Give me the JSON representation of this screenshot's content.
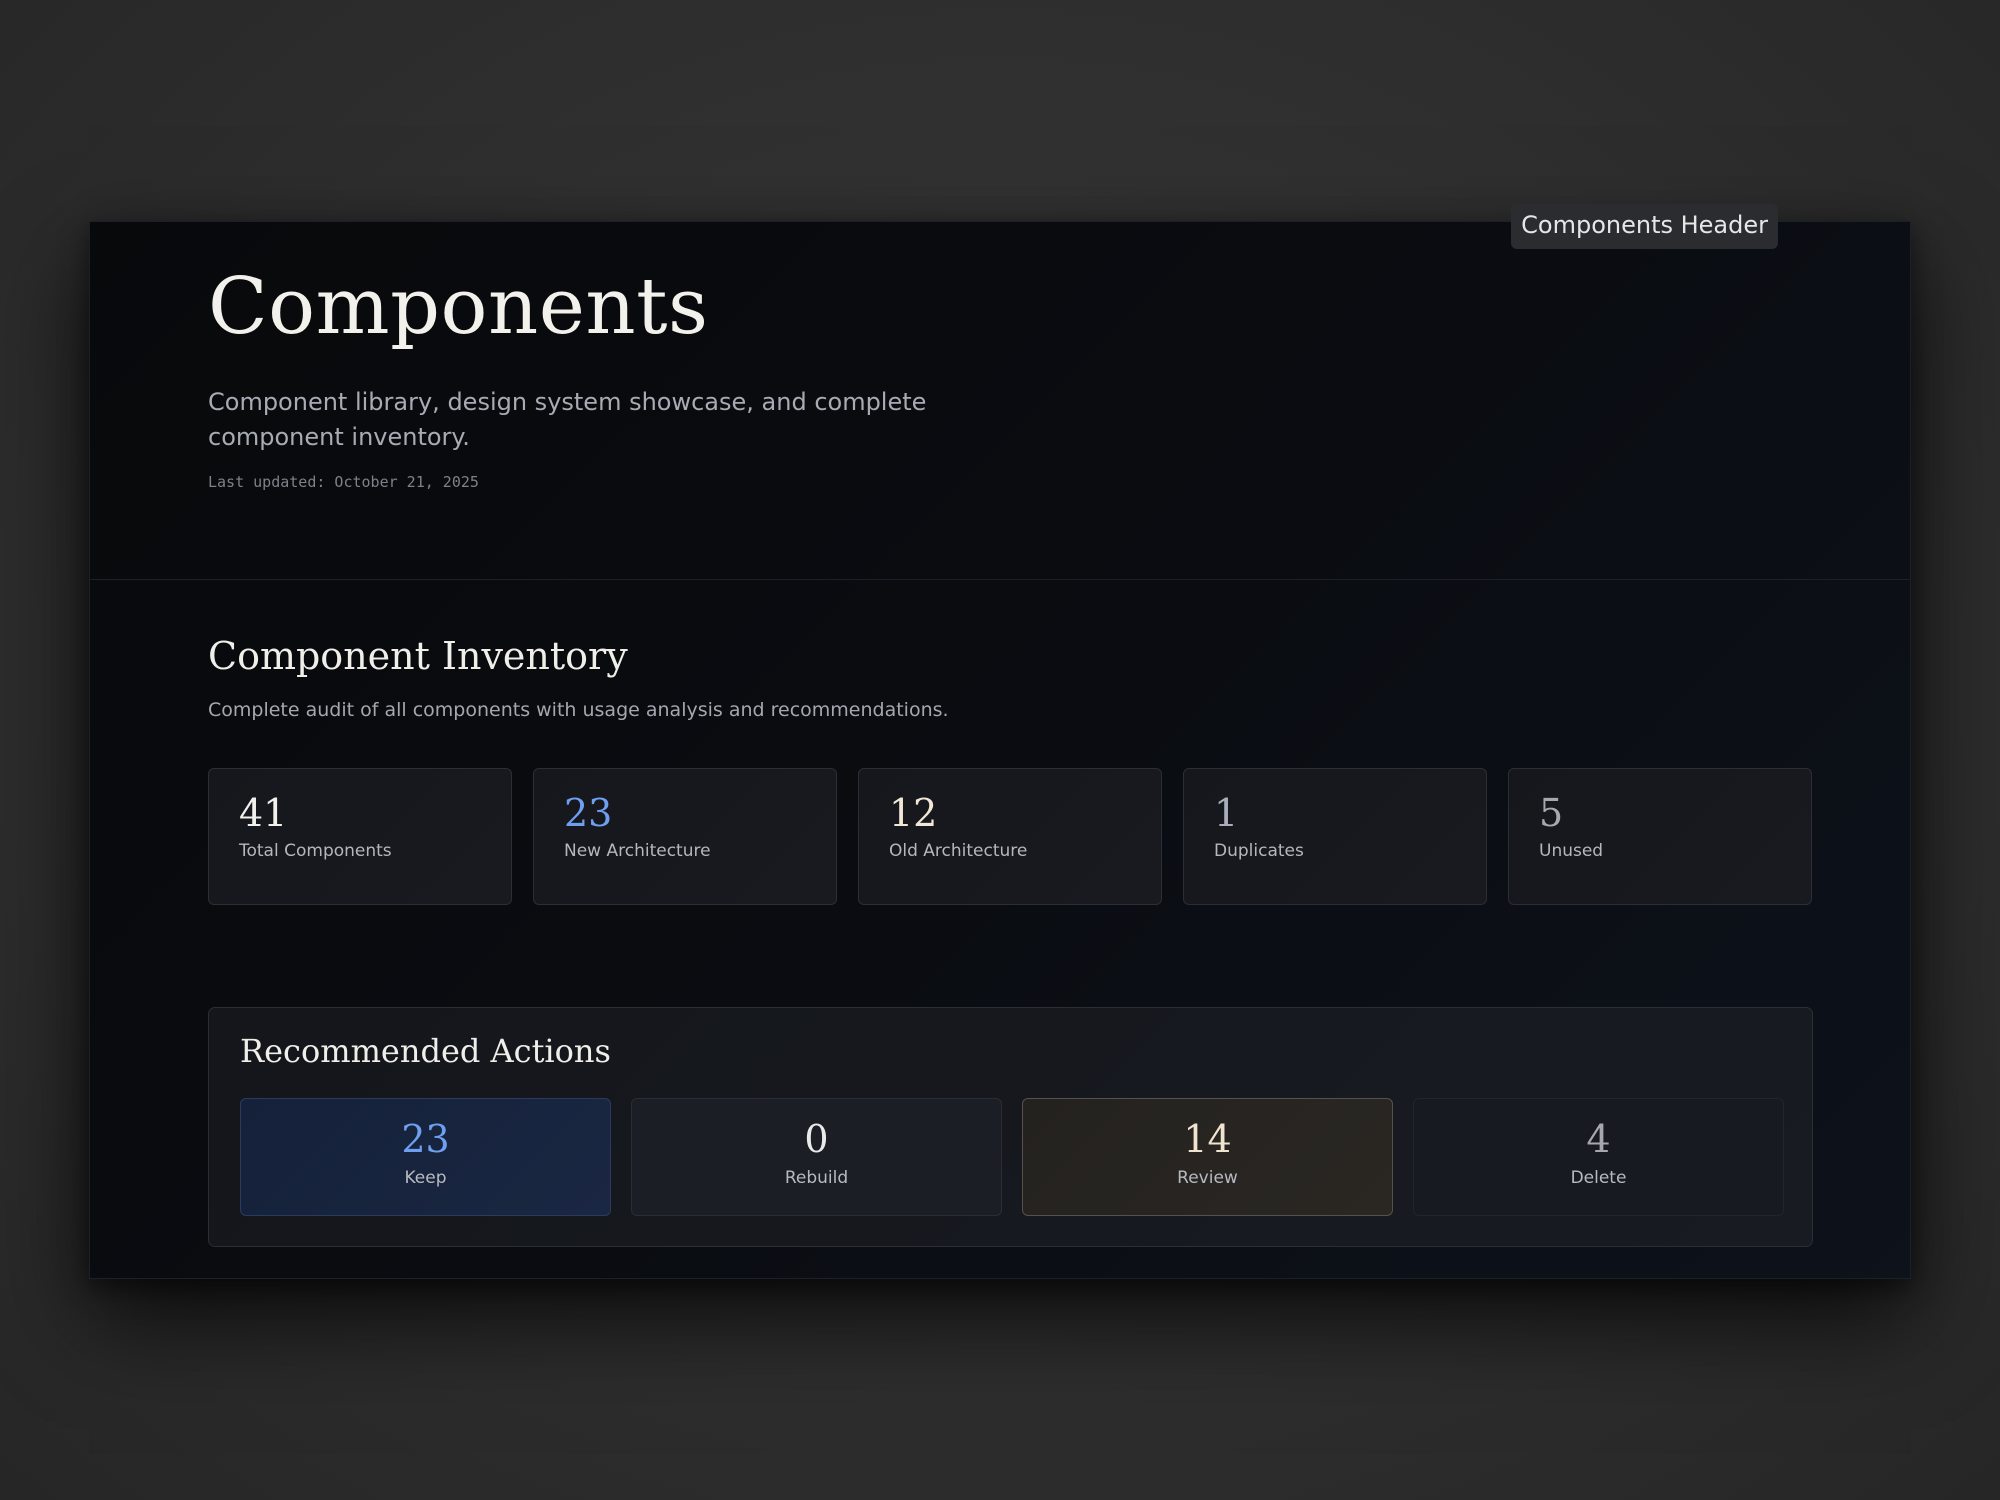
{
  "tooltip": {
    "label": "Components Header"
  },
  "header": {
    "title": "Components",
    "subtitle": "Component library, design system showcase, and complete component inventory.",
    "last_updated": "Last updated: October 21, 2025"
  },
  "inventory": {
    "title": "Component Inventory",
    "description": "Complete audit of all components with usage analysis and recommendations.",
    "stats": [
      {
        "value": "41",
        "label": "Total Components",
        "color": "#f2f0ea"
      },
      {
        "value": "23",
        "label": "New Architecture",
        "color": "#6f9ff0"
      },
      {
        "value": "12",
        "label": "Old Architecture",
        "color": "#f2e6d6"
      },
      {
        "value": "1",
        "label": "Duplicates",
        "color": "#a8aebb"
      },
      {
        "value": "5",
        "label": "Unused",
        "color": "#a6a8ad"
      }
    ]
  },
  "actions": {
    "title": "Recommended Actions",
    "items": [
      {
        "value": "23",
        "label": "Keep",
        "color": "#6f9ff0"
      },
      {
        "value": "0",
        "label": "Rebuild",
        "color": "#e9e9ea"
      },
      {
        "value": "14",
        "label": "Review",
        "color": "#f0e3cf"
      },
      {
        "value": "4",
        "label": "Delete",
        "color": "#a6a8ad"
      }
    ]
  }
}
